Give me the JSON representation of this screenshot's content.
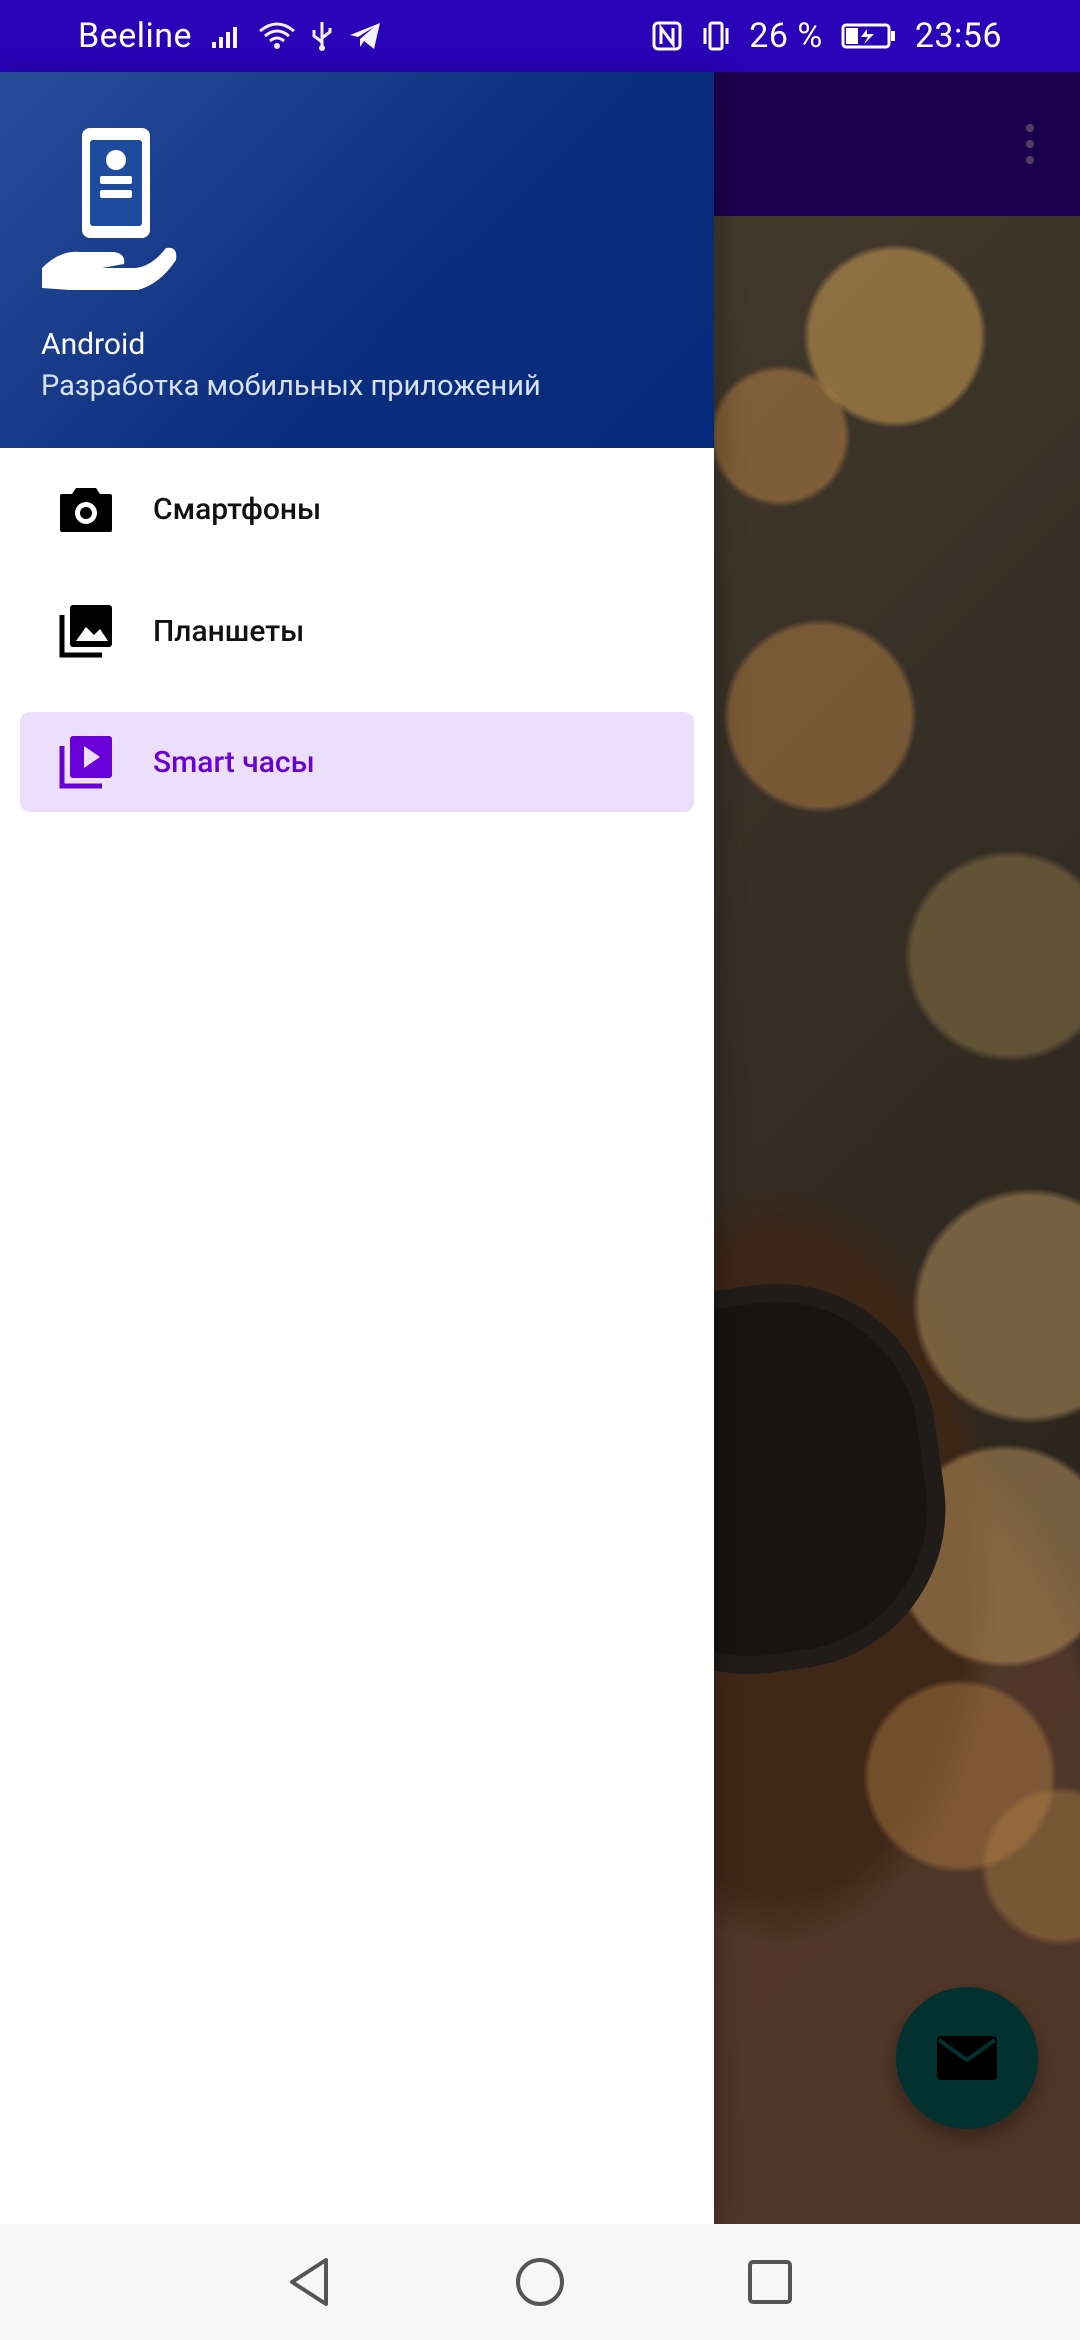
{
  "status_bar": {
    "carrier": "Beeline",
    "battery_percent": "26 %",
    "time": "23:56",
    "icons": [
      "signal-icon",
      "wifi-icon",
      "usb-icon",
      "telegram-icon",
      "nfc-icon",
      "vibrate-icon",
      "battery-charging-icon"
    ]
  },
  "toolbar": {
    "overflow_icon": "more-vertical-icon"
  },
  "drawer": {
    "header": {
      "logo_icon": "phone-in-hand-icon",
      "title": "Android",
      "subtitle": "Разработка мобильных приложений"
    },
    "items": [
      {
        "label": "Смартфоны",
        "icon": "camera-icon",
        "active": false
      },
      {
        "label": "Планшеты",
        "icon": "photo-library-icon",
        "active": false
      },
      {
        "label": "Smart часы",
        "icon": "video-library-icon",
        "active": true
      }
    ]
  },
  "fab": {
    "icon": "mail-icon"
  },
  "nav_bar": {
    "icons": [
      "back-icon",
      "home-icon",
      "recents-icon"
    ]
  },
  "colors": {
    "status_bar": "#2a02b8",
    "toolbar": "#25006a",
    "drawer_header_start": "#2a4d9b",
    "drawer_header_end": "#062a7b",
    "active_item_bg": "#ecdffb",
    "active_item_text": "#6a00d8",
    "fab": "#03423f"
  }
}
